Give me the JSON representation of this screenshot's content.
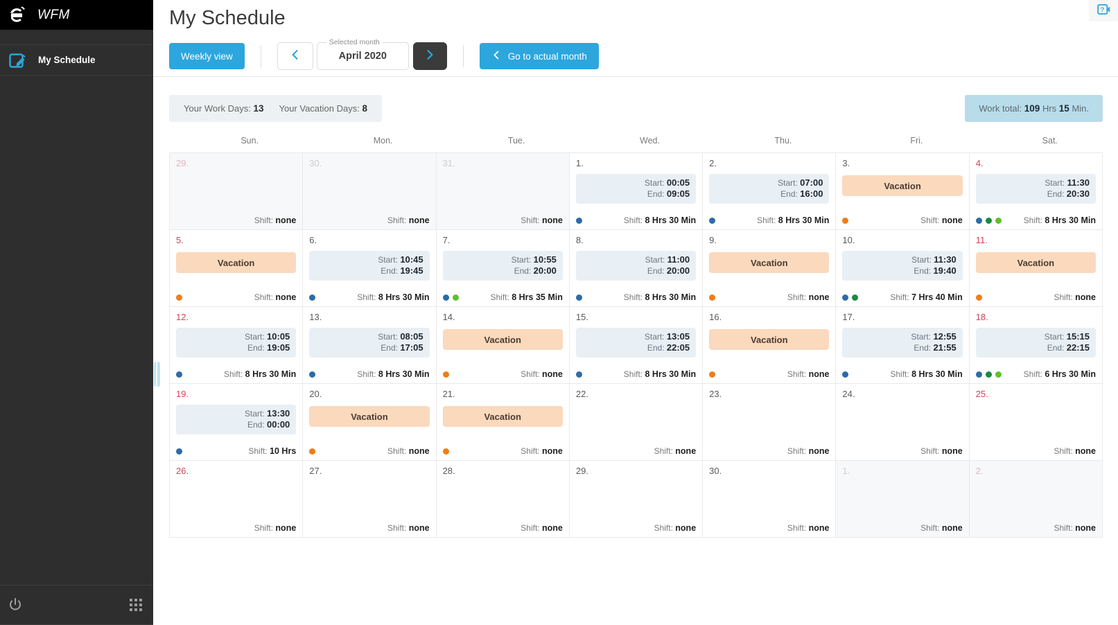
{
  "sidebar": {
    "brand": {
      "logo_icon": "e-logo-icon",
      "name": "WFM"
    },
    "items": [
      {
        "label": "My Schedule",
        "icon": "edit-square-icon",
        "active": true
      }
    ],
    "footer": {
      "power_icon": "power-icon",
      "apps_icon": "apps-grid-icon"
    }
  },
  "header": {
    "title": "My Schedule",
    "help_icon": "help-video-icon"
  },
  "toolbar": {
    "weekly_view_label": "Weekly view",
    "prev_month_icon": "chevron-left-icon",
    "next_month_icon": "chevron-right-icon",
    "month_legend": "Selected month",
    "month_value": "April 2020",
    "actual_month_label": "Go to actual month",
    "actual_month_icon": "chevron-left-icon"
  },
  "stats": {
    "work_days_label": "Your Work Days:",
    "work_days_value": "13",
    "vacation_days_label": "Your Vacation Days:",
    "vacation_days_value": "8",
    "work_total_label": "Work total:",
    "work_total_hours": "109",
    "work_total_hours_unit": "Hrs",
    "work_total_minutes": "15",
    "work_total_minutes_unit": "Min."
  },
  "calendar": {
    "weekdays": [
      "Sun.",
      "Mon.",
      "Tue.",
      "Wed.",
      "Thu.",
      "Fri.",
      "Sat."
    ],
    "labels": {
      "start": "Start:",
      "end": "End:",
      "shift": "Shift:",
      "none": "none",
      "vacation": "Vacation"
    },
    "colors": {
      "dot_blue": "#2b6ca8",
      "dot_green_dark": "#188a42",
      "dot_green_light": "#5fc12a",
      "dot_orange": "#f07d18",
      "shift_bg": "#e8eff5",
      "vacation_bg": "#fbd9bd",
      "accent": "#2ca6dd",
      "weekend_num": "#d0435c"
    },
    "weeks": [
      [
        {
          "num": "29.",
          "out": true,
          "weekend": true,
          "type": "none",
          "shift": "none",
          "dots": []
        },
        {
          "num": "30.",
          "out": true,
          "weekend": false,
          "type": "none",
          "shift": "none",
          "dots": []
        },
        {
          "num": "31.",
          "out": true,
          "weekend": false,
          "type": "none",
          "shift": "none",
          "dots": []
        },
        {
          "num": "1.",
          "out": false,
          "weekend": false,
          "type": "shift",
          "start": "00:05",
          "end": "09:05",
          "shift": "8 Hrs 30 Min",
          "dots": [
            "dot_blue"
          ]
        },
        {
          "num": "2.",
          "out": false,
          "weekend": false,
          "type": "shift",
          "start": "07:00",
          "end": "16:00",
          "shift": "8 Hrs 30 Min",
          "dots": [
            "dot_blue"
          ]
        },
        {
          "num": "3.",
          "out": false,
          "weekend": false,
          "type": "vacation",
          "shift": "none",
          "dots": [
            "dot_orange"
          ]
        },
        {
          "num": "4.",
          "out": false,
          "weekend": true,
          "type": "shift",
          "start": "11:30",
          "end": "20:30",
          "shift": "8 Hrs 30 Min",
          "dots": [
            "dot_blue",
            "dot_green_dark",
            "dot_green_light"
          ]
        }
      ],
      [
        {
          "num": "5.",
          "out": false,
          "weekend": true,
          "type": "vacation",
          "shift": "none",
          "dots": [
            "dot_orange"
          ]
        },
        {
          "num": "6.",
          "out": false,
          "weekend": false,
          "type": "shift",
          "start": "10:45",
          "end": "19:45",
          "shift": "8 Hrs 30 Min",
          "dots": [
            "dot_blue"
          ]
        },
        {
          "num": "7.",
          "out": false,
          "weekend": false,
          "type": "shift",
          "start": "10:55",
          "end": "20:00",
          "shift": "8 Hrs 35 Min",
          "dots": [
            "dot_blue",
            "dot_green_light"
          ]
        },
        {
          "num": "8.",
          "out": false,
          "weekend": false,
          "type": "shift",
          "start": "11:00",
          "end": "20:00",
          "shift": "8 Hrs 30 Min",
          "dots": [
            "dot_blue"
          ]
        },
        {
          "num": "9.",
          "out": false,
          "weekend": false,
          "type": "vacation",
          "shift": "none",
          "dots": [
            "dot_orange"
          ]
        },
        {
          "num": "10.",
          "out": false,
          "weekend": false,
          "type": "shift",
          "start": "11:30",
          "end": "19:40",
          "shift": "7 Hrs 40 Min",
          "dots": [
            "dot_blue",
            "dot_green_dark"
          ]
        },
        {
          "num": "11.",
          "out": false,
          "weekend": true,
          "type": "vacation",
          "shift": "none",
          "dots": [
            "dot_orange"
          ]
        }
      ],
      [
        {
          "num": "12.",
          "out": false,
          "weekend": true,
          "type": "shift",
          "start": "10:05",
          "end": "19:05",
          "shift": "8 Hrs 30 Min",
          "dots": [
            "dot_blue"
          ]
        },
        {
          "num": "13.",
          "out": false,
          "weekend": false,
          "type": "shift",
          "start": "08:05",
          "end": "17:05",
          "shift": "8 Hrs 30 Min",
          "dots": [
            "dot_blue"
          ]
        },
        {
          "num": "14.",
          "out": false,
          "weekend": false,
          "type": "vacation",
          "shift": "none",
          "dots": [
            "dot_orange"
          ]
        },
        {
          "num": "15.",
          "out": false,
          "weekend": false,
          "type": "shift",
          "start": "13:05",
          "end": "22:05",
          "shift": "8 Hrs 30 Min",
          "dots": [
            "dot_blue"
          ]
        },
        {
          "num": "16.",
          "out": false,
          "weekend": false,
          "type": "vacation",
          "shift": "none",
          "dots": [
            "dot_orange"
          ]
        },
        {
          "num": "17.",
          "out": false,
          "weekend": false,
          "type": "shift",
          "start": "12:55",
          "end": "21:55",
          "shift": "8 Hrs 30 Min",
          "dots": [
            "dot_blue"
          ]
        },
        {
          "num": "18.",
          "out": false,
          "weekend": true,
          "type": "shift",
          "start": "15:15",
          "end": "22:15",
          "shift": "6 Hrs 30 Min",
          "dots": [
            "dot_blue",
            "dot_green_dark",
            "dot_green_light"
          ]
        }
      ],
      [
        {
          "num": "19.",
          "out": false,
          "weekend": true,
          "type": "shift",
          "start": "13:30",
          "end": "00:00",
          "shift": "10 Hrs",
          "dots": [
            "dot_blue"
          ]
        },
        {
          "num": "20.",
          "out": false,
          "weekend": false,
          "type": "vacation",
          "shift": "none",
          "dots": [
            "dot_orange"
          ]
        },
        {
          "num": "21.",
          "out": false,
          "weekend": false,
          "type": "vacation",
          "shift": "none",
          "dots": [
            "dot_orange"
          ]
        },
        {
          "num": "22.",
          "out": false,
          "weekend": false,
          "type": "none",
          "shift": "none",
          "dots": []
        },
        {
          "num": "23.",
          "out": false,
          "weekend": false,
          "type": "none",
          "shift": "none",
          "dots": []
        },
        {
          "num": "24.",
          "out": false,
          "weekend": false,
          "type": "none",
          "shift": "none",
          "dots": []
        },
        {
          "num": "25.",
          "out": false,
          "weekend": true,
          "type": "none",
          "shift": "none",
          "dots": []
        }
      ],
      [
        {
          "num": "26.",
          "out": false,
          "weekend": true,
          "type": "none",
          "shift": "none",
          "dots": []
        },
        {
          "num": "27.",
          "out": false,
          "weekend": false,
          "type": "none",
          "shift": "none",
          "dots": []
        },
        {
          "num": "28.",
          "out": false,
          "weekend": false,
          "type": "none",
          "shift": "none",
          "dots": []
        },
        {
          "num": "29.",
          "out": false,
          "weekend": false,
          "type": "none",
          "shift": "none",
          "dots": []
        },
        {
          "num": "30.",
          "out": false,
          "weekend": false,
          "type": "none",
          "shift": "none",
          "dots": []
        },
        {
          "num": "1.",
          "out": true,
          "weekend": false,
          "type": "none",
          "shift": "none",
          "dots": []
        },
        {
          "num": "2.",
          "out": true,
          "weekend": true,
          "type": "none",
          "shift": "none",
          "dots": []
        }
      ]
    ]
  }
}
